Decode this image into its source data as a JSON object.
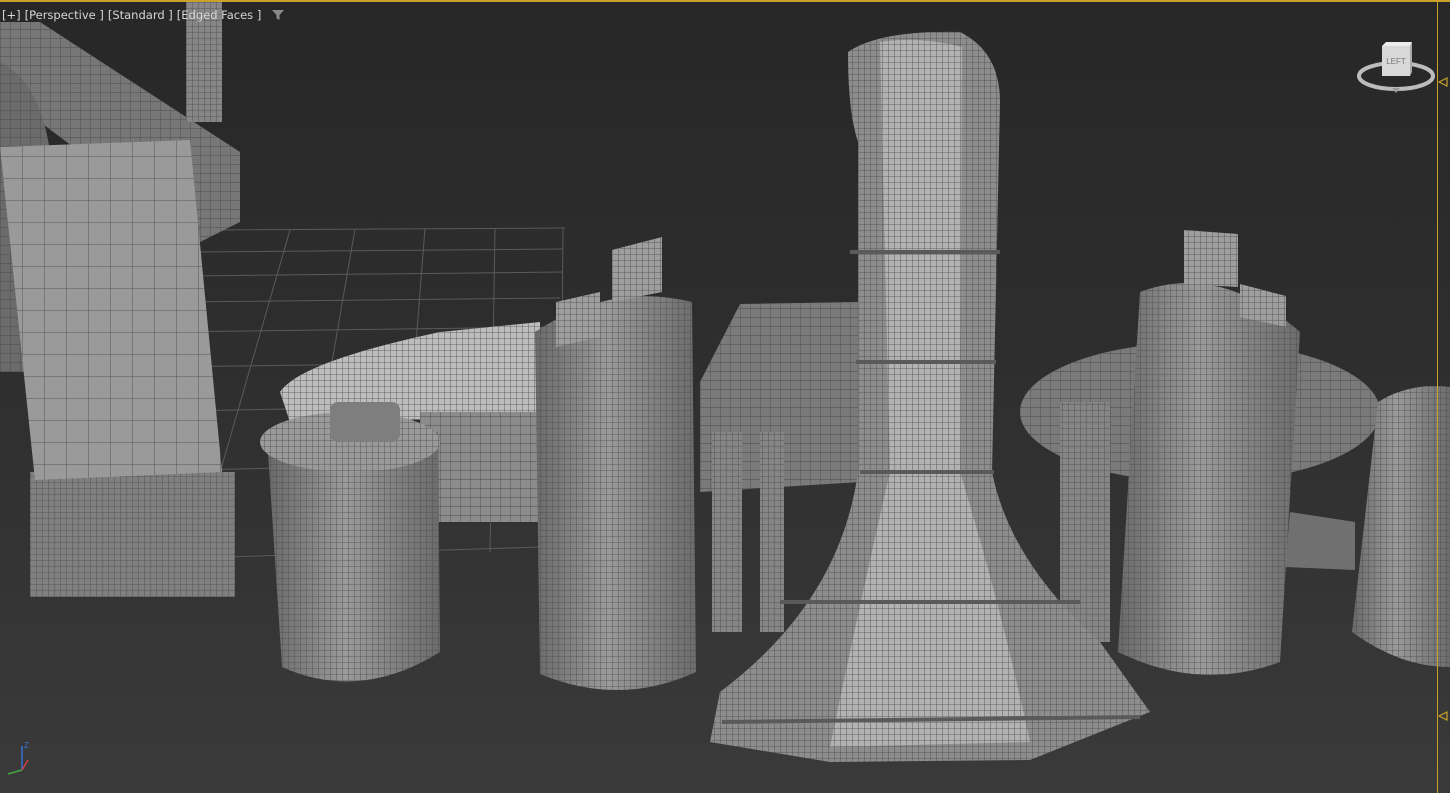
{
  "viewport": {
    "labels": [
      "[+]",
      "[Perspective ]",
      "[Standard ]",
      "[Edged Faces ]"
    ],
    "viewcube_face": "LEFT",
    "axis_label": "Z"
  },
  "icons": [
    "filter-icon",
    "viewcube-icon",
    "axis-gizmo-icon",
    "timeline-marker-icon"
  ],
  "colors": {
    "background": "#2e2e2e",
    "geometry": "#8a8a8a",
    "wire": "#4a4a4a",
    "highlight_border": "#c9a227",
    "label": "#d6d6d6"
  }
}
